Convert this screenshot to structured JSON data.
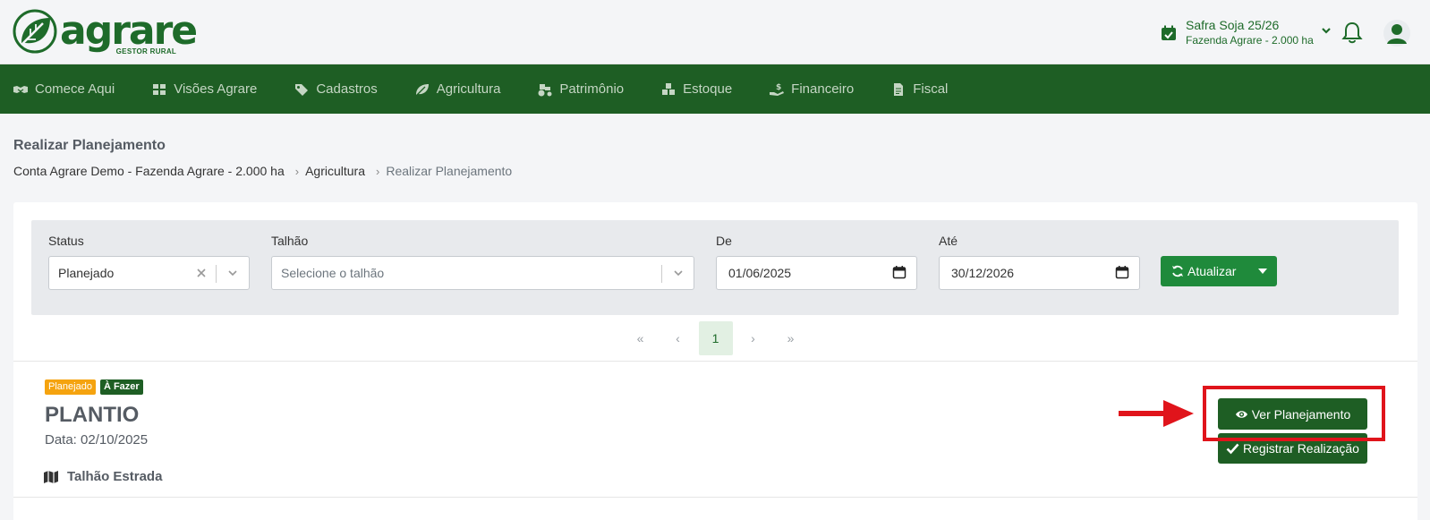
{
  "header": {
    "brand": "agrare",
    "brand_sub": "GESTOR RURAL",
    "safra_title": "Safra Soja 25/26",
    "safra_sub": "Fazenda Agrare - 2.000 ha"
  },
  "nav": {
    "items": [
      {
        "label": "Comece Aqui",
        "icon": "handshake-icon"
      },
      {
        "label": "Visões Agrare",
        "icon": "dashboard-icon"
      },
      {
        "label": "Cadastros",
        "icon": "tags-icon"
      },
      {
        "label": "Agricultura",
        "icon": "leaf-icon"
      },
      {
        "label": "Patrimônio",
        "icon": "tractor-icon"
      },
      {
        "label": "Estoque",
        "icon": "boxes-icon"
      },
      {
        "label": "Financeiro",
        "icon": "money-hand-icon"
      },
      {
        "label": "Fiscal",
        "icon": "document-icon"
      }
    ]
  },
  "page": {
    "title": "Realizar Planejamento",
    "breadcrumb": [
      "Conta Agrare Demo - Fazenda Agrare - 2.000 ha",
      "Agricultura",
      "Realizar Planejamento"
    ]
  },
  "filters": {
    "status_label": "Status",
    "status_value": "Planejado",
    "talhao_label": "Talhão",
    "talhao_placeholder": "Selecione o talhão",
    "de_label": "De",
    "de_value": "01/06/2025",
    "ate_label": "Até",
    "ate_value": "30/12/2026",
    "refresh_label": "Atualizar"
  },
  "pagination": {
    "first": "«",
    "prev": "‹",
    "current": "1",
    "next": "›",
    "last": "»"
  },
  "item": {
    "badge_status": "Planejado",
    "badge_todo": "À Fazer",
    "title": "PLANTIO",
    "date": "Data: 02/10/2025",
    "talhao": "Talhão Estrada",
    "ver_label": "Ver Planejamento",
    "registrar_label": "Registrar Realização"
  },
  "colors": {
    "brand_green": "#1e6b2a",
    "nav_bg": "#1e5e24",
    "refresh_btn": "#1f8a3b",
    "badge_orange": "#f5a30f",
    "highlight_red": "#e0141b"
  }
}
